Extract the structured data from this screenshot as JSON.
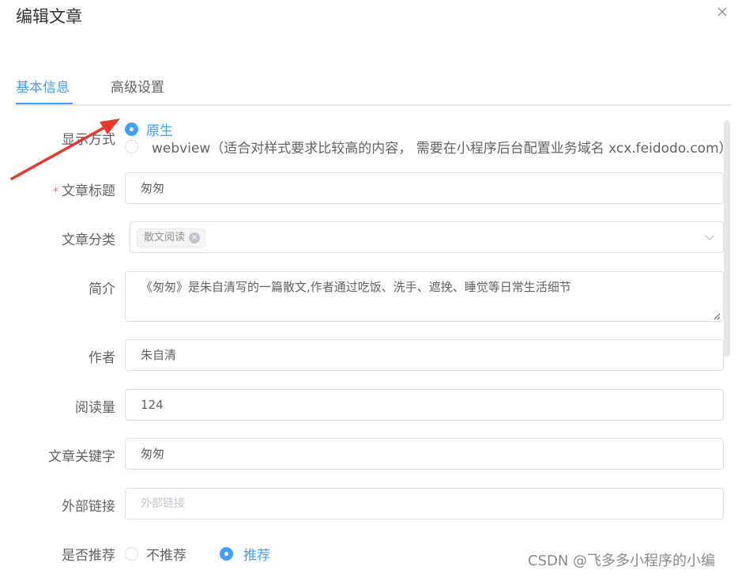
{
  "dialog": {
    "title": "编辑文章",
    "close_icon": "close-icon"
  },
  "tabs": [
    {
      "label": "基本信息",
      "active": true
    },
    {
      "label": "高级设置",
      "active": false
    }
  ],
  "form": {
    "display_mode": {
      "label": "显示方式",
      "options": [
        {
          "label": "原生",
          "checked": true
        },
        {
          "label": "webview（适合对样式要求比较高的内容， 需要在小程序后台配置业务域名 xcx.feidodo.com）",
          "checked": false
        }
      ]
    },
    "title": {
      "label": "文章标题",
      "required": "*",
      "value": "匆匆"
    },
    "category": {
      "label": "文章分类",
      "tags": [
        "散文阅读"
      ],
      "tag_close": "×",
      "chevron_icon": "chevron-down-icon"
    },
    "summary": {
      "label": "简介",
      "value": "《匆匆》是朱自清写的一篇散文,作者通过吃饭、洗手、遮挽、睡觉等日常生活细节"
    },
    "author": {
      "label": "作者",
      "value": "朱自清"
    },
    "reads": {
      "label": "阅读量",
      "value": "124"
    },
    "keywords": {
      "label": "文章关键字",
      "value": "匆匆"
    },
    "external_link": {
      "label": "外部链接",
      "value": "",
      "placeholder": "外部链接"
    },
    "recommend": {
      "label": "是否推荐",
      "options": [
        {
          "label": "不推荐",
          "checked": false
        },
        {
          "label": "推荐",
          "checked": true
        }
      ]
    }
  },
  "watermark": "CSDN @飞多多小程序的小编",
  "colors": {
    "accent": "#409eff",
    "required": "#f56c6c",
    "annotation_arrow": "#e8382c"
  }
}
